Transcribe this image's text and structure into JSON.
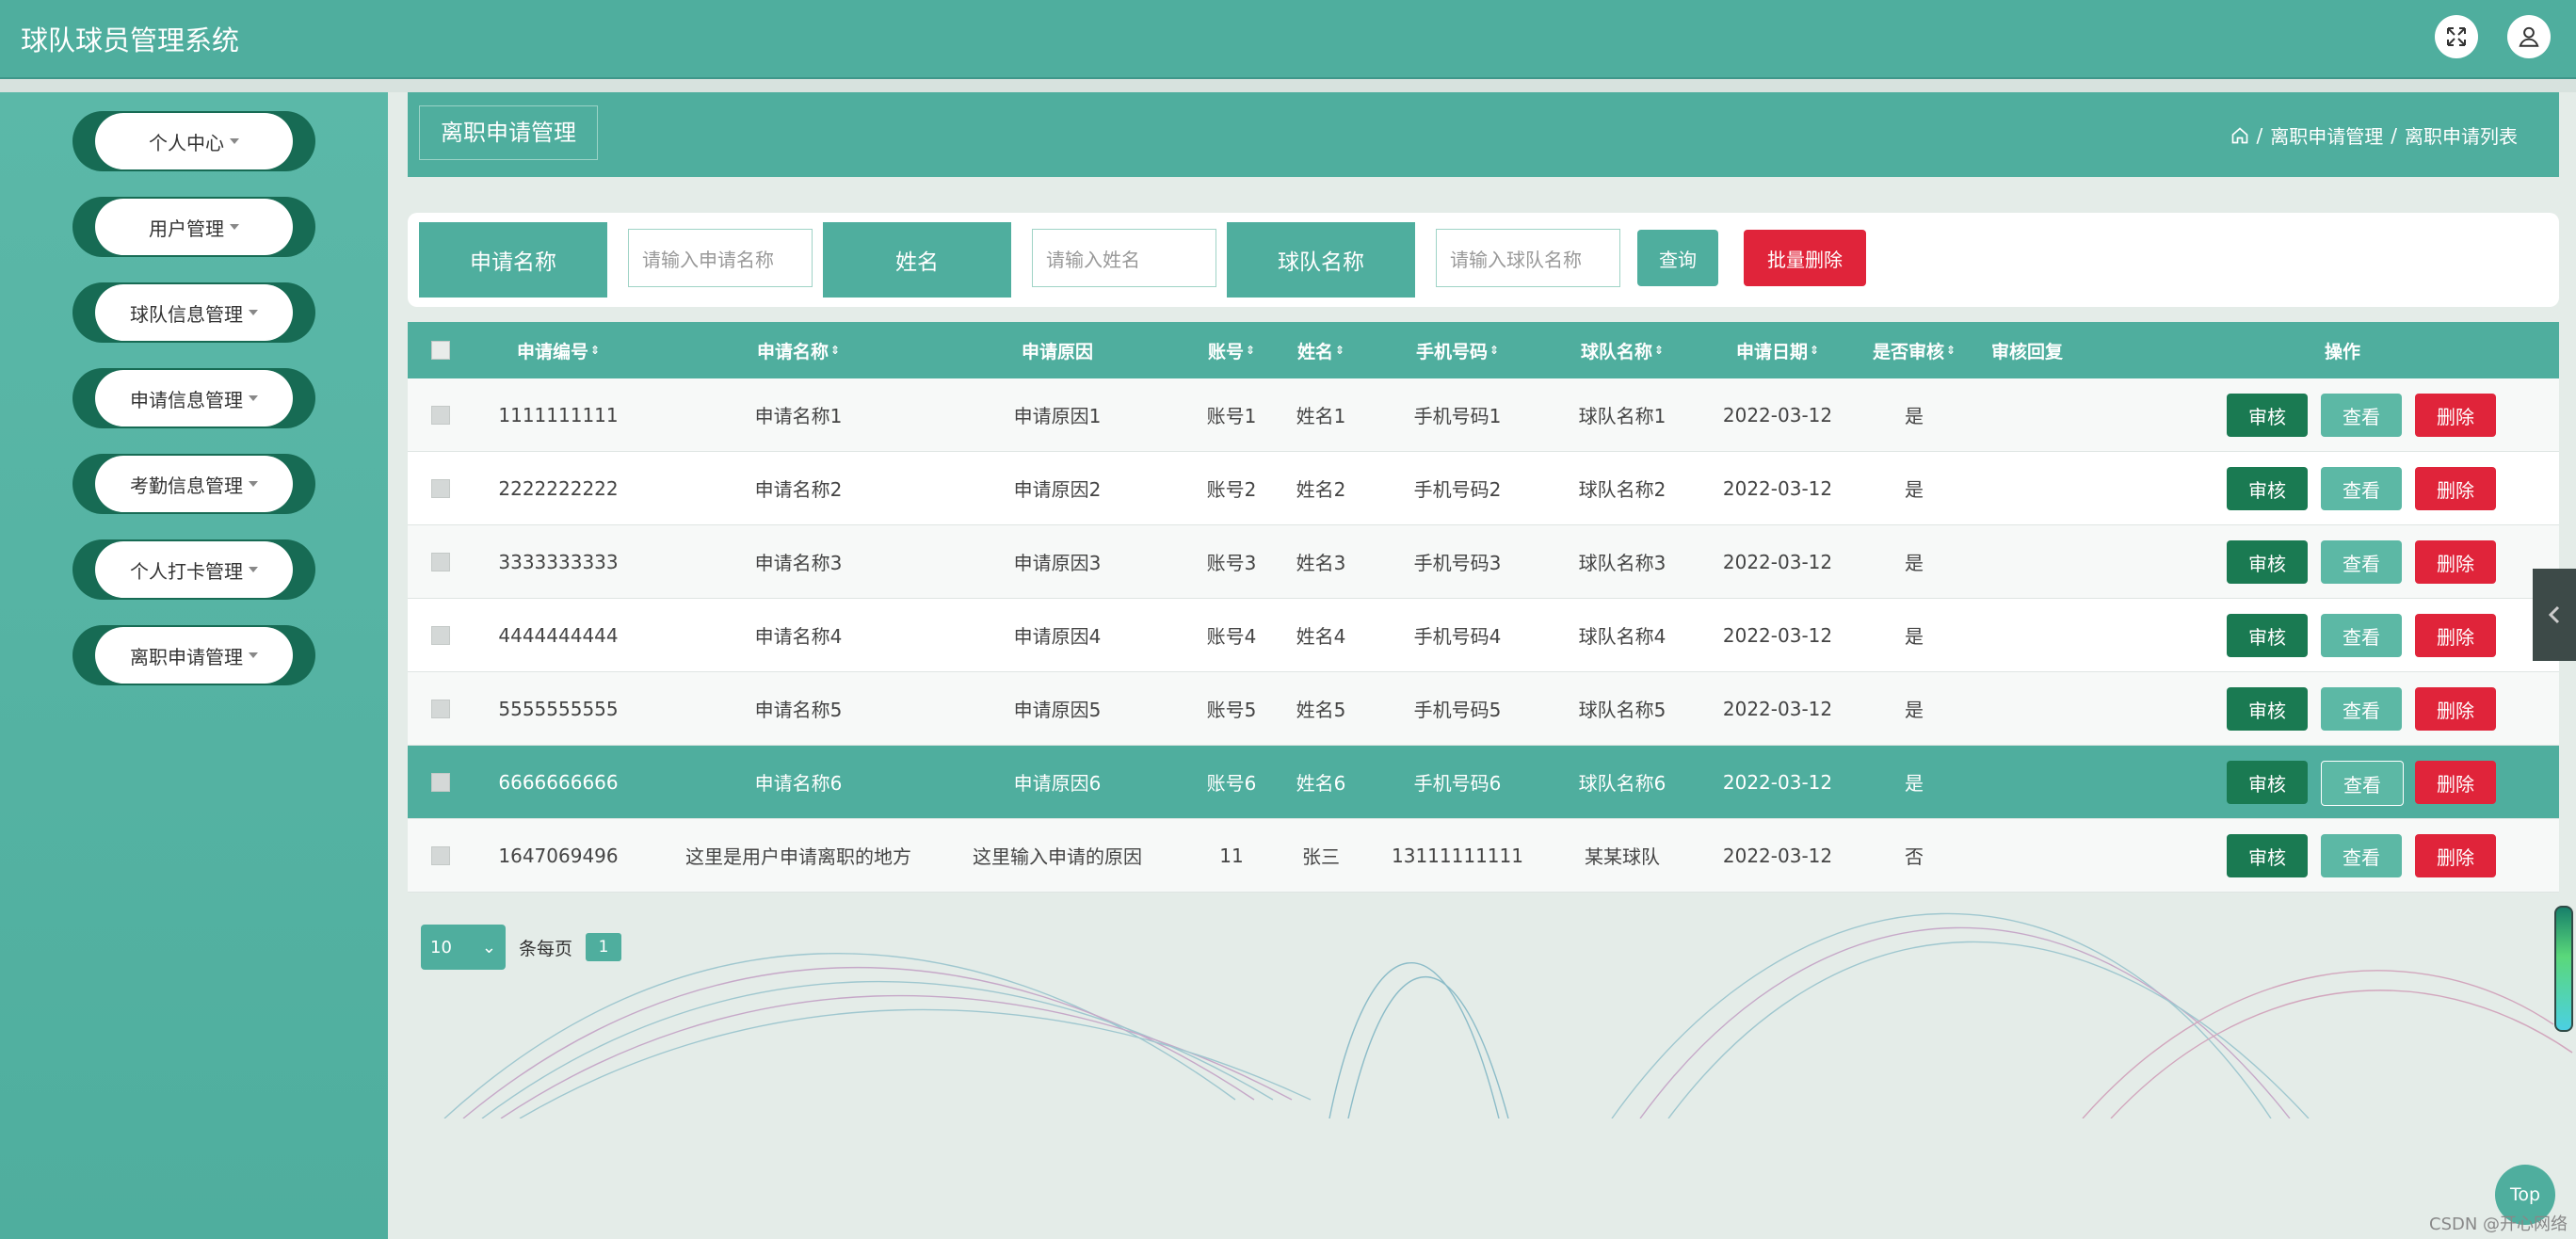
{
  "app": {
    "title": "球队球员管理系统"
  },
  "header": {
    "fullscreen_icon": "expand-icon",
    "user_icon": "user-icon"
  },
  "sidebar": {
    "items": [
      {
        "label": "个人中心"
      },
      {
        "label": "用户管理"
      },
      {
        "label": "球队信息管理"
      },
      {
        "label": "申请信息管理"
      },
      {
        "label": "考勤信息管理"
      },
      {
        "label": "个人打卡管理"
      },
      {
        "label": "离职申请管理"
      }
    ]
  },
  "page": {
    "title": "离职申请管理",
    "breadcrumb": [
      "离职申请管理",
      "离职申请列表"
    ],
    "breadcrumb_sep": "/"
  },
  "search": {
    "label1": "申请名称",
    "placeholder1": "请输入申请名称",
    "label2": "姓名",
    "placeholder2": "请输入姓名",
    "label3": "球队名称",
    "placeholder3": "请输入球队名称",
    "query_label": "查询",
    "batch_delete_label": "批量删除"
  },
  "table": {
    "columns": [
      "申请编号",
      "申请名称",
      "申请原因",
      "账号",
      "姓名",
      "手机号码",
      "球队名称",
      "申请日期",
      "是否审核",
      "审核回复",
      "操作"
    ],
    "rows": [
      [
        "1111111111",
        "申请名称1",
        "申请原因1",
        "账号1",
        "姓名1",
        "手机号码1",
        "球队名称1",
        "2022-03-12",
        "是",
        ""
      ],
      [
        "2222222222",
        "申请名称2",
        "申请原因2",
        "账号2",
        "姓名2",
        "手机号码2",
        "球队名称2",
        "2022-03-12",
        "是",
        ""
      ],
      [
        "3333333333",
        "申请名称3",
        "申请原因3",
        "账号3",
        "姓名3",
        "手机号码3",
        "球队名称3",
        "2022-03-12",
        "是",
        ""
      ],
      [
        "4444444444",
        "申请名称4",
        "申请原因4",
        "账号4",
        "姓名4",
        "手机号码4",
        "球队名称4",
        "2022-03-12",
        "是",
        ""
      ],
      [
        "5555555555",
        "申请名称5",
        "申请原因5",
        "账号5",
        "姓名5",
        "手机号码5",
        "球队名称5",
        "2022-03-12",
        "是",
        ""
      ],
      [
        "6666666666",
        "申请名称6",
        "申请原因6",
        "账号6",
        "姓名6",
        "手机号码6",
        "球队名称6",
        "2022-03-12",
        "是",
        ""
      ],
      [
        "1647069496",
        "这里是用户申请离职的地方",
        "这里输入申请的原因",
        "11",
        "张三",
        "13111111111",
        "某某球队",
        "2022-03-12",
        "否",
        ""
      ]
    ],
    "actions": {
      "audit": "审核",
      "view": "查看",
      "delete": "删除"
    }
  },
  "pagination": {
    "page_size": "10",
    "per_page_label": "条每页",
    "current_page": "1"
  },
  "floating": {
    "top_label": "Top",
    "watermark": "CSDN @开心网络"
  },
  "colors": {
    "primary": "#4fae9e",
    "audit": "#1a7a52",
    "view": "#5cb8a5",
    "delete": "#e0243a"
  }
}
